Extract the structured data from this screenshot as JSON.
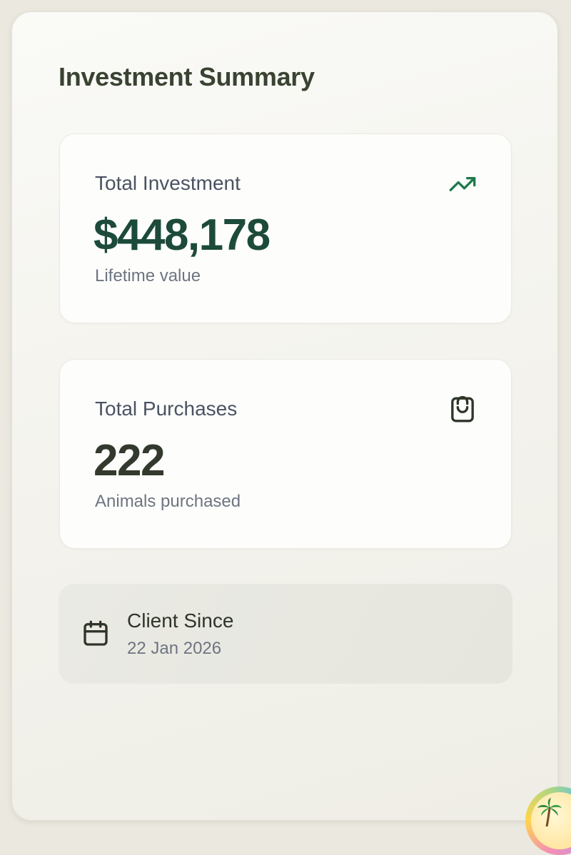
{
  "summary": {
    "title": "Investment Summary"
  },
  "investment": {
    "label": "Total Investment",
    "value": "$448,178",
    "subtitle": "Lifetime value",
    "icon": "trending-up-icon",
    "icon_color": "#1f7a4a"
  },
  "purchases": {
    "label": "Total Purchases",
    "value": "222",
    "subtitle": "Animals purchased",
    "icon": "shopping-bag-icon",
    "icon_color": "#2f3529"
  },
  "client": {
    "label": "Client Since",
    "date": "22 Jan 2026",
    "icon": "calendar-icon"
  },
  "assistant": {
    "icon": "palm-tree-icon"
  },
  "colors": {
    "investment_value": "#1c4a3b",
    "purchases_value": "#333a2d",
    "label_text": "#4a5262",
    "muted_text": "#6e7481",
    "background": "#ebe9df"
  }
}
